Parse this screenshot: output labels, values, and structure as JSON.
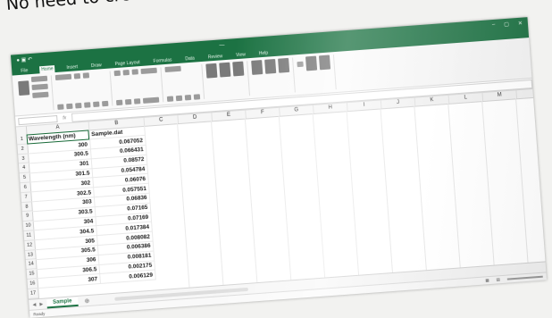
{
  "caption": "No need to create a CSV file each time.",
  "excel": {
    "tabs": [
      "File",
      "Home",
      "Insert",
      "Draw",
      "Page Layout",
      "Formulas",
      "Data",
      "Review",
      "View",
      "Help"
    ],
    "columns": [
      "A",
      "B",
      "C",
      "D",
      "E",
      "F",
      "G",
      "H",
      "I",
      "J",
      "K",
      "L",
      "M"
    ],
    "table": {
      "headers": [
        "Wavelength (nm)",
        "Sample.dat"
      ],
      "rows": [
        [
          "300",
          "0.067052"
        ],
        [
          "300.5",
          "0.066431"
        ],
        [
          "301",
          "0.08572"
        ],
        [
          "301.5",
          "0.054784"
        ],
        [
          "302",
          "0.06076"
        ],
        [
          "302.5",
          "0.057551"
        ],
        [
          "303",
          "0.06836"
        ],
        [
          "303.5",
          "0.07165"
        ],
        [
          "304",
          "0.07169"
        ],
        [
          "304.5",
          "0.017384"
        ],
        [
          "305",
          "0.008082"
        ],
        [
          "305.5",
          "0.006386"
        ],
        [
          "306",
          "0.008181"
        ],
        [
          "306.5",
          "0.002175"
        ],
        [
          "307",
          "0.006129"
        ]
      ]
    },
    "sheet_tab": "Sample",
    "status": "Ready",
    "accent": "#217346"
  }
}
